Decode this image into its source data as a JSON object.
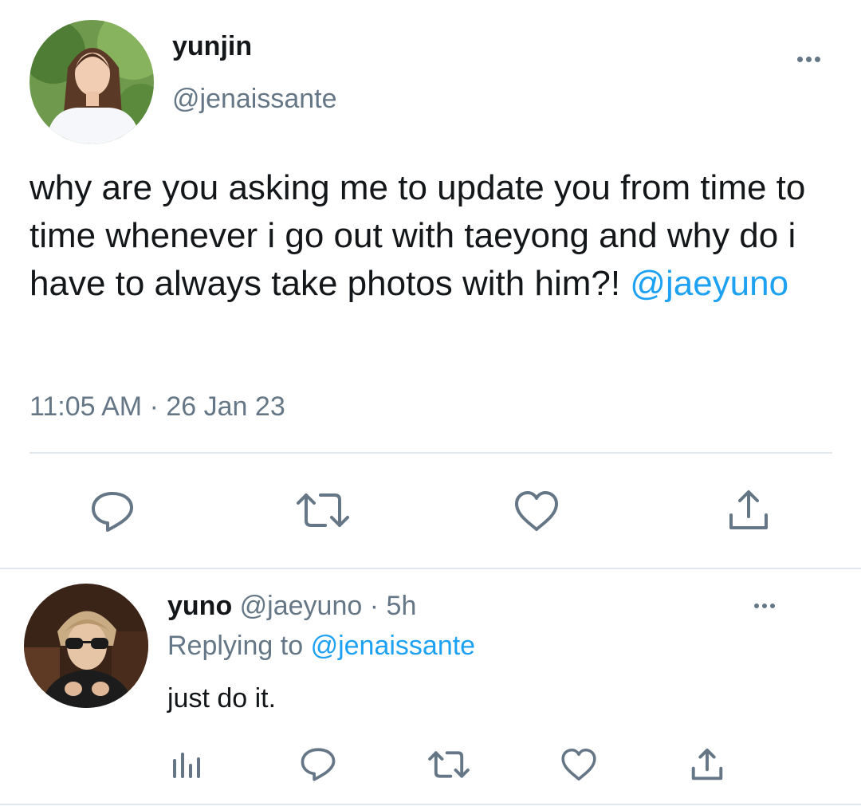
{
  "main_tweet": {
    "display_name": "yunjin",
    "handle": "@jenaissante",
    "text": "why are you asking me to update you from time to time whenever i go out with taeyong and why do i have to always take photos with him?!",
    "mention": "@jaeyuno",
    "time": "11:05 AM",
    "separator": "·",
    "date": "26 Jan 23",
    "more_icon": "more-horizontal-icon",
    "actions": [
      "reply-icon",
      "retweet-icon",
      "like-icon",
      "share-icon"
    ]
  },
  "reply": {
    "display_name": "yuno",
    "handle": "@jaeyuno",
    "separator": "·",
    "age": "5h",
    "replying_label": "Replying to",
    "replying_handle": "@jenaissante",
    "text": "just do it.",
    "more_icon": "more-horizontal-icon",
    "actions": [
      "analytics-icon",
      "reply-icon",
      "retweet-icon",
      "like-icon",
      "share-icon"
    ]
  },
  "colors": {
    "text": "#14171a",
    "muted": "#657786",
    "link": "#1da1f2",
    "divider": "#e1e8ed"
  }
}
